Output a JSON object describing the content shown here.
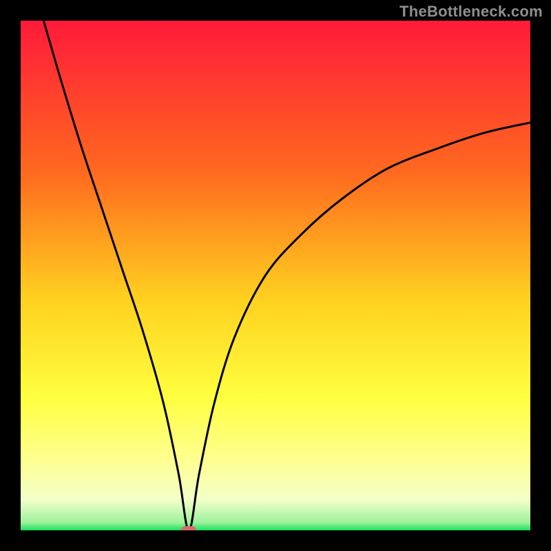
{
  "attribution": "TheBottleneck.com",
  "colors": {
    "bg": "#000000",
    "curve": "#000000",
    "gradient_top": "#ff1a3a",
    "gradient_mid1": "#ff7a1f",
    "gradient_mid2": "#ffd21f",
    "gradient_mid3": "#ffff66",
    "gradient_mid4": "#f6ffb3",
    "gradient_bottom": "#18e05a",
    "marker": "#d76a6a",
    "attribution": "#8f8f8f"
  },
  "chart_data": {
    "type": "line",
    "title": "",
    "xlabel": "",
    "ylabel": "",
    "xlim": [
      0,
      100
    ],
    "ylim": [
      0,
      100
    ],
    "min_x": 33,
    "left_start": {
      "x": 4.5,
      "y": 100
    },
    "right_end": {
      "x": 100,
      "y": 80
    },
    "marker": {
      "x": 33,
      "y": 0
    },
    "series": [
      {
        "name": "bottleneck-curve",
        "x": [
          4.5,
          8,
          12,
          16,
          20,
          24,
          28,
          31,
          33,
          35,
          38,
          42,
          48,
          55,
          63,
          72,
          82,
          91,
          100
        ],
        "y": [
          100,
          88,
          75,
          63,
          51,
          39,
          25,
          11,
          0,
          11,
          25,
          38,
          50,
          58,
          65,
          71,
          75,
          78,
          80
        ]
      }
    ]
  }
}
